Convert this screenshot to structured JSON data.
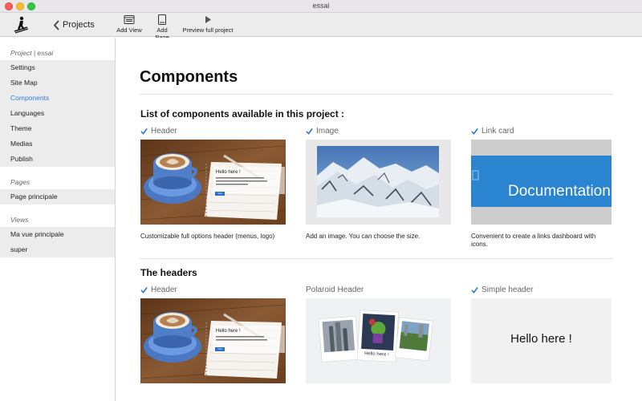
{
  "window": {
    "title": "essai"
  },
  "toolbar": {
    "back_label": "Projects",
    "add_view": "Add View",
    "add_page": "Add Page",
    "preview": "Preview full project"
  },
  "sidebar": {
    "project_title": "Project | essai",
    "project_items": [
      {
        "label": "Settings",
        "active": false
      },
      {
        "label": "Site Map",
        "active": false
      },
      {
        "label": "Components",
        "active": true
      },
      {
        "label": "Languages",
        "active": false
      },
      {
        "label": "Theme",
        "active": false
      },
      {
        "label": "Medias",
        "active": false
      },
      {
        "label": "Publish",
        "active": false
      }
    ],
    "pages_title": "Pages",
    "pages_items": [
      {
        "label": "Page principale"
      }
    ],
    "views_title": "Views",
    "views_items": [
      {
        "label": "Ma vue principale"
      },
      {
        "label": "super"
      }
    ]
  },
  "main": {
    "title": "Components",
    "section1_title": "List of components available in this project :",
    "section1_cards": [
      {
        "name": "Header",
        "checked": true,
        "desc": "Customizable full options header (menus, logo)",
        "thumb_text": "Hello here !",
        "thumb_button": "Start"
      },
      {
        "name": "Image",
        "checked": true,
        "desc": "Add an image. You can choose the size."
      },
      {
        "name": "Link card",
        "checked": true,
        "desc": "Convenient to create a links dashboard with icons.",
        "thumb_text": "Documentation"
      }
    ],
    "section2_title": "The headers",
    "section2_cards": [
      {
        "name": "Header",
        "checked": true,
        "thumb_text": "Hello here !",
        "thumb_button": "Start"
      },
      {
        "name": "Polaroid Header",
        "checked": false,
        "thumb_text": "Hello here !"
      },
      {
        "name": "Simple header",
        "checked": true,
        "thumb_text": "Hello here !"
      }
    ]
  },
  "colors": {
    "accent": "#2f7de1",
    "check": "#2a7ad8",
    "link_card_blue": "#2a84cf"
  }
}
